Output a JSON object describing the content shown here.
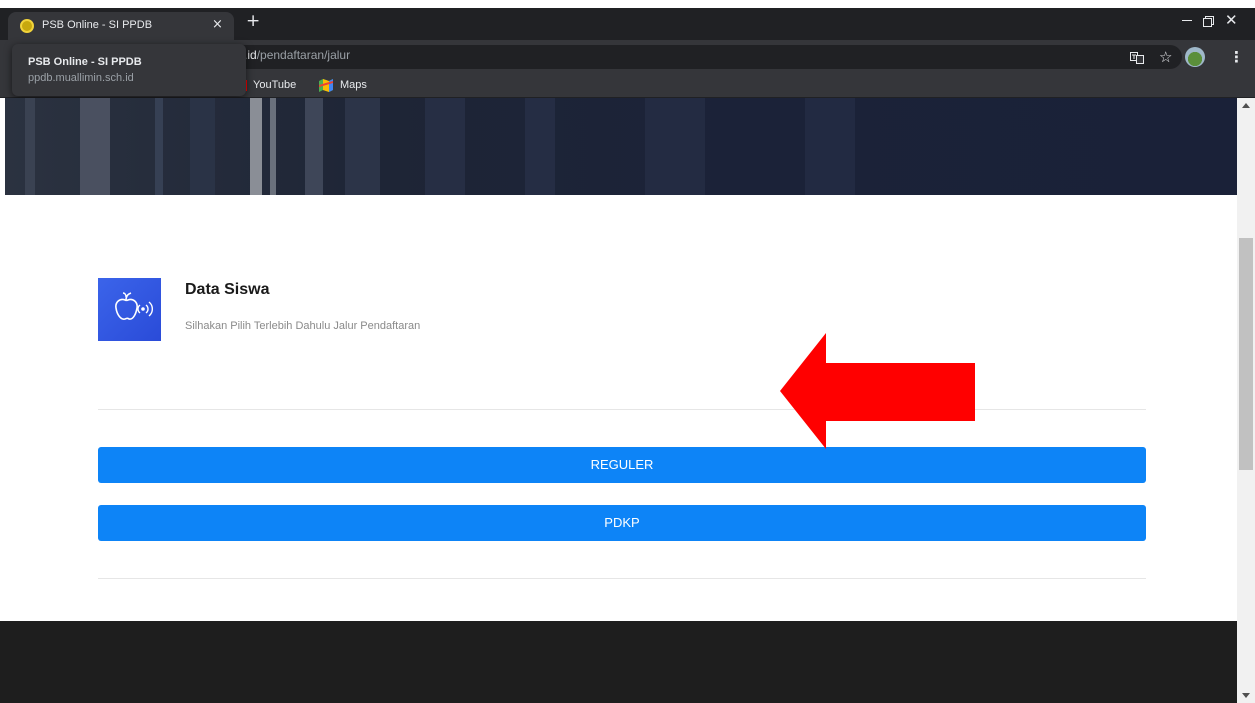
{
  "browser": {
    "tab_title": "PSB Online - SI PPDB",
    "tab_close": "×",
    "new_tab": "+",
    "window_close": "✕",
    "url_host": ".id",
    "url_path": "/pendaftaran/jalur",
    "star": "☆",
    "menu": "⋮",
    "hovercard": {
      "title": "PSB Online - SI PPDB",
      "url": "ppdb.muallimin.sch.id"
    },
    "bookmarks": [
      {
        "label": "YouTube",
        "icon": "youtube-icon"
      },
      {
        "label": "Maps",
        "icon": "maps-icon"
      }
    ]
  },
  "page": {
    "feature": {
      "title": "Data Siswa",
      "subtitle": "Silhakan Pilih Terlebih Dahulu Jalur Pendaftaran",
      "icon": "apple-signal-icon"
    },
    "buttons": {
      "reguler": "REGULER",
      "pdkp": "PDKP"
    },
    "annotation": {
      "icon": "red-arrow-left",
      "color": "#ff0000"
    }
  },
  "colors": {
    "primary_button": "#0d84f7",
    "icon_gradient": "#3b64ea",
    "footer": "#1e1e1e",
    "annotation_arrow": "#ff0000"
  }
}
